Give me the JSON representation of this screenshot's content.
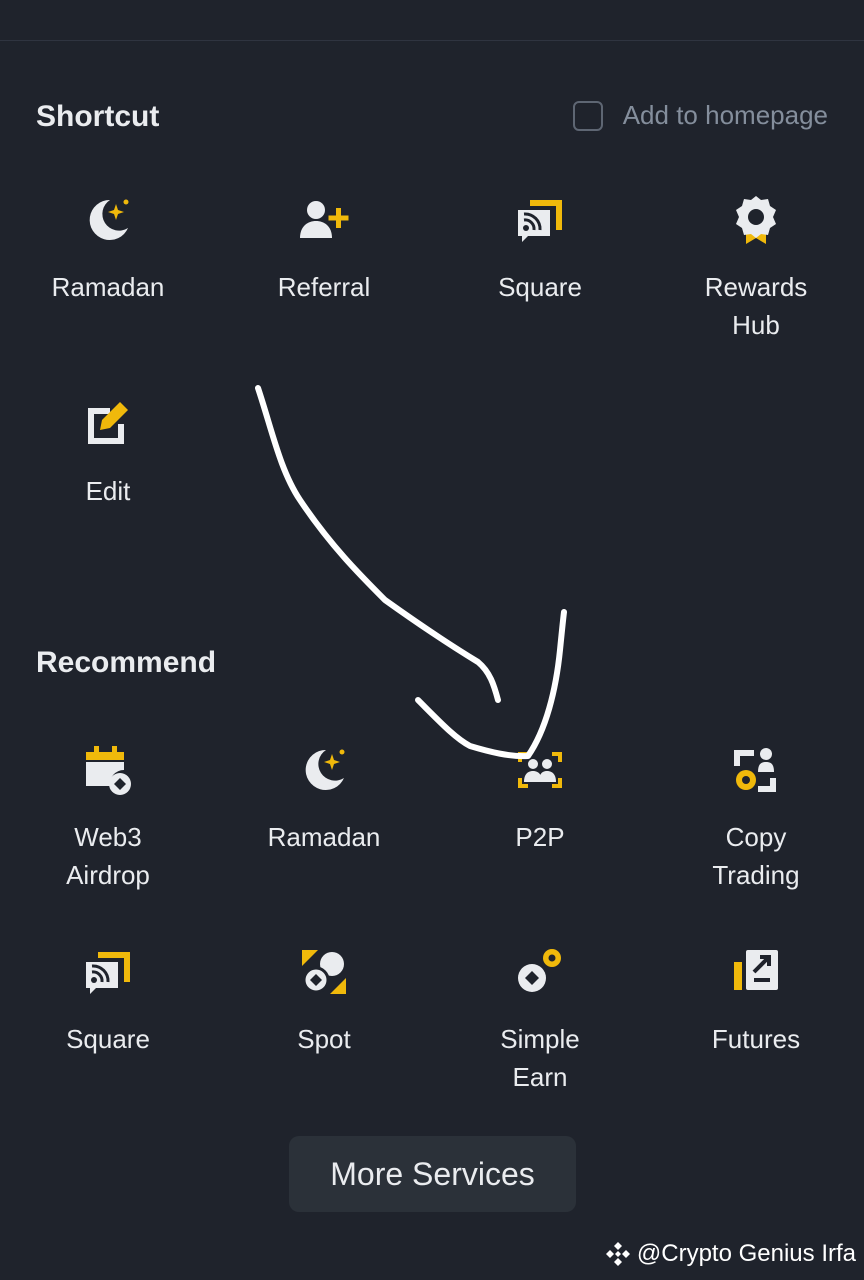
{
  "colors": {
    "background": "#1f232c",
    "accent_yellow": "#f0b90b",
    "icon_white": "#eaecef",
    "muted_text": "#848e9c",
    "button_bg": "#2b3139"
  },
  "shortcut": {
    "title": "Shortcut",
    "add_to_homepage": "Add to homepage",
    "items": [
      {
        "label": "Ramadan",
        "icon": "crescent-star-icon"
      },
      {
        "label": "Referral",
        "icon": "add-user-icon"
      },
      {
        "label": "Square",
        "icon": "square-feed-icon"
      },
      {
        "label": "Rewards\nHub",
        "icon": "rewards-badge-icon"
      },
      {
        "label": "Edit",
        "icon": "edit-icon"
      }
    ]
  },
  "recommend": {
    "title": "Recommend",
    "items": [
      {
        "label": "Web3\nAirdrop",
        "icon": "calendar-airdrop-icon"
      },
      {
        "label": "Ramadan",
        "icon": "crescent-star-icon"
      },
      {
        "label": "P2P",
        "icon": "p2p-users-icon"
      },
      {
        "label": "Copy\nTrading",
        "icon": "copy-trading-icon"
      },
      {
        "label": "Square",
        "icon": "square-feed-icon"
      },
      {
        "label": "Spot",
        "icon": "spot-icon"
      },
      {
        "label": "Simple\nEarn",
        "icon": "simple-earn-icon"
      },
      {
        "label": "Futures",
        "icon": "futures-icon"
      }
    ]
  },
  "more_services": "More Services",
  "watermark": "@Crypto Genius Irfa"
}
